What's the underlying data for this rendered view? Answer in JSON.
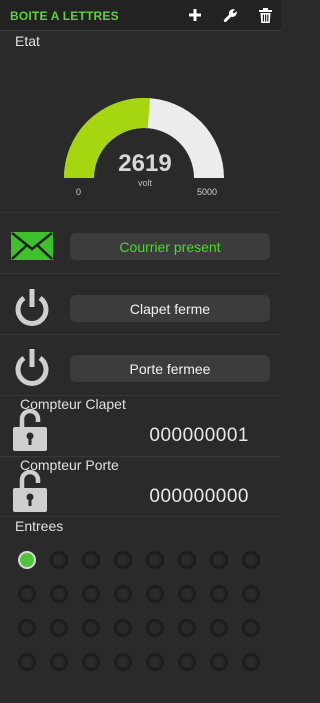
{
  "header": {
    "title": "BOITE A LETTRES",
    "icons": [
      "plus-icon",
      "wrench-icon",
      "trash-icon"
    ]
  },
  "etat": {
    "label": "Etat",
    "gauge": {
      "value": "2619",
      "unit": "volt",
      "min": "0",
      "max": "5000",
      "fill_fraction": 0.5238,
      "fill_color": "#a5d610",
      "track_color": "#ececec"
    }
  },
  "rows": [
    {
      "icon": "envelope-icon",
      "label": "Courrier present",
      "color": "#3ee21b"
    },
    {
      "icon": "power-icon",
      "label": "Clapet ferme"
    },
    {
      "icon": "power-icon",
      "label": "Porte fermee"
    }
  ],
  "counters": [
    {
      "label": "Compteur Clapet",
      "icon": "unlock-icon",
      "value": "000000001"
    },
    {
      "label": "Compteur Porte",
      "icon": "unlock-icon",
      "value": "000000000"
    }
  ],
  "entrees": {
    "label": "Entrees",
    "leds_on": [
      0
    ],
    "led_count": 32,
    "on_color": "#4fc43a"
  }
}
